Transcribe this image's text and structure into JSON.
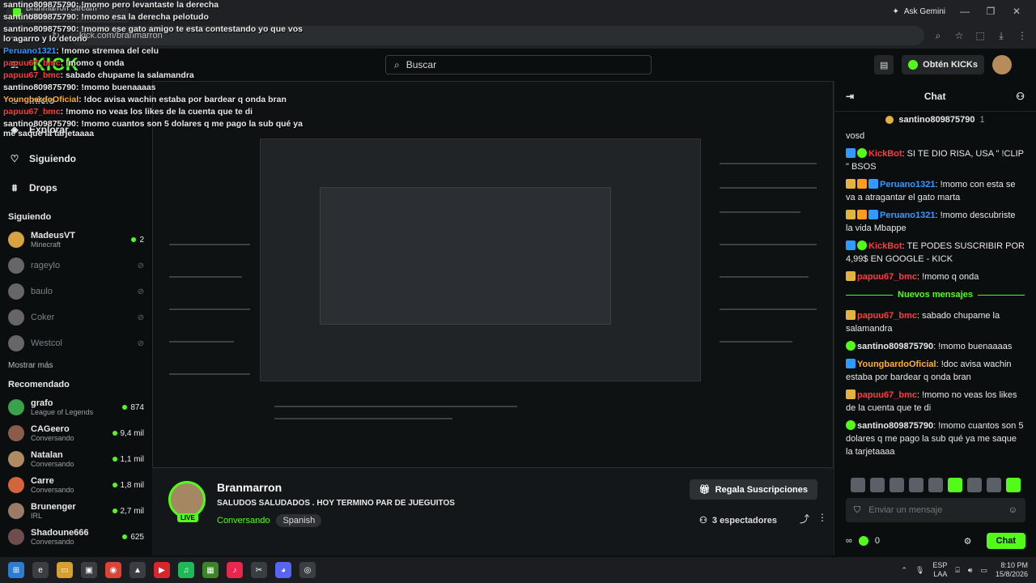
{
  "browser": {
    "tab_title": "Branmarron Stream - Watch Li...",
    "url": "kick.com/branmarron",
    "ask_gemini": "Ask Gemini"
  },
  "header": {
    "logo": "KICK",
    "search_placeholder": "Buscar",
    "get_kicks": "Obtén KICKs"
  },
  "sidebar": {
    "nav": [
      {
        "label": "Inicio",
        "icon": "home-icon"
      },
      {
        "label": "Explorar",
        "icon": "compass-icon"
      },
      {
        "label": "Siguiendo",
        "icon": "heart-icon"
      },
      {
        "label": "Drops",
        "icon": "drops-icon"
      }
    ],
    "following_title": "Siguiendo",
    "following": [
      {
        "name": "MadeusVT",
        "category": "Minecraft",
        "viewers": "2",
        "live": true
      },
      {
        "name": "rageylo",
        "category": "",
        "viewers": "",
        "live": false
      },
      {
        "name": "baulo",
        "category": "",
        "viewers": "",
        "live": false
      },
      {
        "name": "Coker",
        "category": "",
        "viewers": "",
        "live": false
      },
      {
        "name": "Westcol",
        "category": "",
        "viewers": "",
        "live": false
      }
    ],
    "show_more": "Mostrar más",
    "recommended_title": "Recomendado",
    "recommended": [
      {
        "name": "grafo",
        "category": "League of Legends",
        "viewers": "874"
      },
      {
        "name": "CAGeero",
        "category": "Conversando",
        "viewers": "9,4 mil"
      },
      {
        "name": "Natalan",
        "category": "Conversando",
        "viewers": "1,1 mil"
      },
      {
        "name": "Carre",
        "category": "Conversando",
        "viewers": "1,8 mil"
      },
      {
        "name": "Brunenger",
        "category": "IRL",
        "viewers": "2,7 mil"
      },
      {
        "name": "Shadoune666",
        "category": "Conversando",
        "viewers": "625"
      }
    ]
  },
  "stream": {
    "streamer": "Branmarron",
    "title": "SALUDOS SALUDADOS . HOY TERMINO PAR DE JUEGUITOS",
    "category": "Conversando",
    "language": "Spanish",
    "live_label": "LIVE",
    "subscribe_label": "Regala Suscripciones",
    "viewers": "3 espectadores"
  },
  "chat": {
    "title": "Chat",
    "pinned_user": "santino809875790",
    "pinned_count": "1",
    "new_messages": "Nuevos mensajes",
    "messages": [
      {
        "user": "",
        "text": "vosd",
        "color": "u-white",
        "badges": []
      },
      {
        "user": "KickBot",
        "text": ": SI TE DIO RISA, USA \" !CLIP \" BSOS",
        "color": "u-red",
        "badges": [
          "b-blue",
          "b-verified"
        ]
      },
      {
        "user": "Peruano1321",
        "text": ": !momo con esta se va a atragantar el gato marta",
        "color": "u-blue",
        "badges": [
          "b-sub",
          "b-crown",
          "b-blue"
        ]
      },
      {
        "user": "Peruano1321",
        "text": ": !momo descubriste la vida Mbappe",
        "color": "u-blue",
        "badges": [
          "b-sub",
          "b-crown",
          "b-blue"
        ]
      },
      {
        "user": "KickBot",
        "text": ": TE PODES SUSCRIBIR POR 4,99$ EN GOOGLE - KICK",
        "color": "u-red",
        "badges": [
          "b-blue",
          "b-verified"
        ]
      },
      {
        "user": "papuu67_bmc",
        "text": ": !momo q onda",
        "color": "u-red",
        "badges": [
          "b-sub"
        ]
      }
    ],
    "new_list": [
      {
        "user": "papuu67_bmc",
        "text": ": sabado chupame la salamandra",
        "color": "u-red",
        "badges": [
          "b-sub"
        ]
      },
      {
        "user": "santino809875790",
        "text": ": !momo buenaaaas",
        "color": "u-white",
        "badges": [
          "b-verified"
        ]
      },
      {
        "user": "YoungbardoOficial",
        "text": ": !doc avisa wachin estaba por bardear q onda bran",
        "color": "u-orange",
        "badges": [
          "b-blue"
        ]
      },
      {
        "user": "papuu67_bmc",
        "text": ": !momo no veas los likes de la cuenta que te di",
        "color": "u-red",
        "badges": [
          "b-sub"
        ]
      },
      {
        "user": "santino809875790",
        "text": ": !momo cuantos son 5 dolares q me pago la sub qué ya me saque la tarjetaaaa",
        "color": "u-white",
        "badges": [
          "b-verified"
        ]
      }
    ],
    "input_placeholder": "Enviar un mensaje",
    "kicks_count": "0",
    "send_label": "Chat"
  },
  "overlay": [
    {
      "user": "santino809875790",
      "text": ": !momo pero levantaste la derecha",
      "color": "u-white"
    },
    {
      "user": "santino809875790",
      "text": ": !momo esa la derecha pelotudo",
      "color": "u-white"
    },
    {
      "user": "santino809875790",
      "text": ": !momo ese gato amigo te esta contestando yo que vos lo agarro y lo detono",
      "color": "u-white"
    },
    {
      "user": "Peruano1321",
      "text": ": !momo stremea del celu",
      "color": "u-blue"
    },
    {
      "user": "papuu67_bmc",
      "text": ": !momo q onda",
      "color": "u-red"
    },
    {
      "user": "papuu67_bmc",
      "text": ": sabado chupame la salamandra",
      "color": "u-red"
    },
    {
      "user": "santino809875790",
      "text": ": !momo buenaaaas",
      "color": "u-white"
    },
    {
      "user": "YoungbardoOficial",
      "text": ": !doc avisa wachin estaba por bardear q onda bran",
      "color": "u-orange"
    },
    {
      "user": "papuu67_bmc",
      "text": ": !momo no veas los likes de la cuenta que te di",
      "color": "u-red"
    },
    {
      "user": "santino809875790",
      "text": ": !momo cuantos son 5 dolares q me pago la sub qué ya me saque la tarjetaaaa",
      "color": "u-white"
    }
  ],
  "taskbar": {
    "lang": "ESP",
    "lang2": "LAA",
    "time": "8:10 PM",
    "date": "15/8/2026"
  }
}
